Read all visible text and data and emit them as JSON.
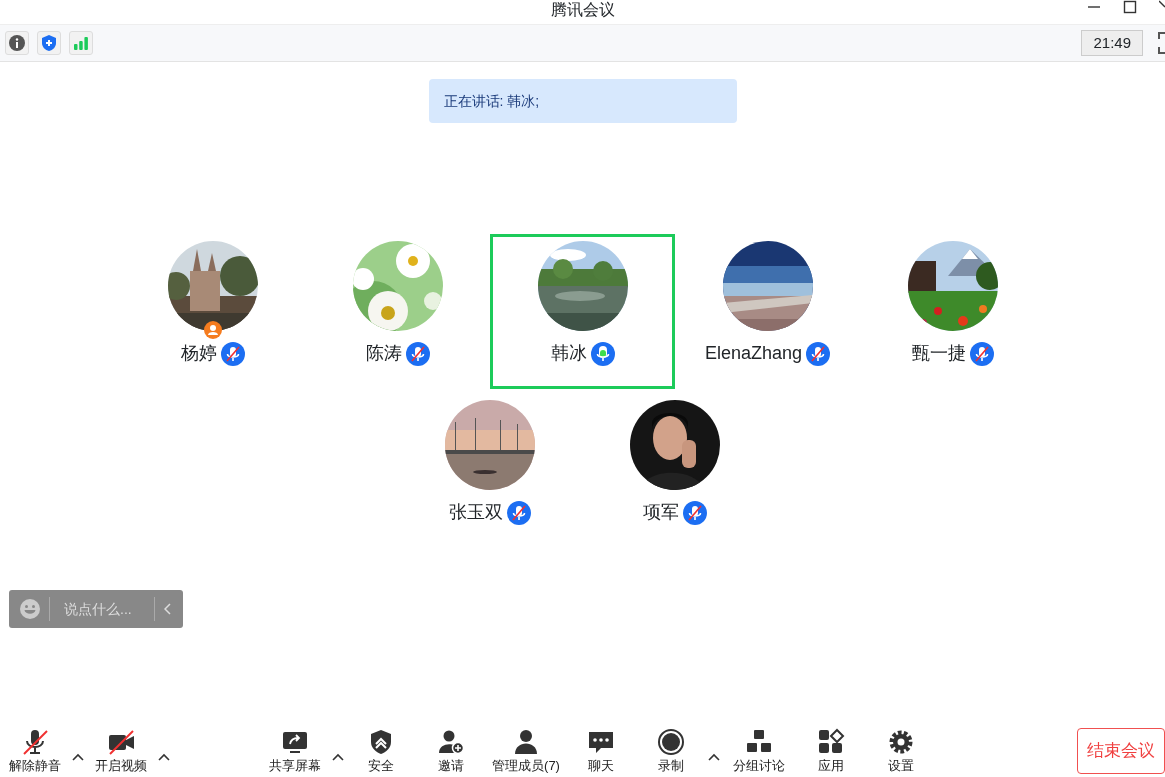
{
  "window": {
    "title": "腾讯会议"
  },
  "top_bar": {
    "icons": [
      {
        "kind": "info"
      },
      {
        "kind": "shield"
      },
      {
        "kind": "signal"
      }
    ],
    "time": "21:49"
  },
  "speaking_banner": "正在讲话: 韩冰;",
  "participants": [
    {
      "name": "杨婷",
      "mic_muted": true,
      "speaking": false,
      "host": true,
      "selected": false
    },
    {
      "name": "陈涛",
      "mic_muted": true,
      "speaking": false,
      "host": false,
      "selected": false
    },
    {
      "name": "韩冰",
      "mic_muted": false,
      "speaking": true,
      "host": false,
      "selected": true
    },
    {
      "name": "ElenaZhang",
      "mic_muted": true,
      "speaking": false,
      "host": false,
      "selected": false
    },
    {
      "name": "甄一捷",
      "mic_muted": true,
      "speaking": false,
      "host": false,
      "selected": false
    },
    {
      "name": "张玉双",
      "mic_muted": true,
      "speaking": false,
      "host": false,
      "selected": false
    },
    {
      "name": "项军",
      "mic_muted": true,
      "speaking": false,
      "host": false,
      "selected": false
    }
  ],
  "chat_input": {
    "placeholder": "说点什么..."
  },
  "toolbar": [
    {
      "kind": "mic",
      "label": "解除静音",
      "off": true,
      "has_menu": true
    },
    {
      "kind": "camera",
      "label": "开启视频",
      "off": true,
      "has_menu": true
    },
    {
      "kind": "share",
      "label": "共享屏幕",
      "off": false,
      "has_menu": true
    },
    {
      "kind": "security",
      "label": "安全",
      "off": false,
      "has_menu": false
    },
    {
      "kind": "invite",
      "label": "邀请",
      "off": false,
      "has_menu": false
    },
    {
      "kind": "members",
      "label": "管理成员(7)",
      "off": false,
      "has_menu": false
    },
    {
      "kind": "chat",
      "label": "聊天",
      "off": false,
      "has_menu": false
    },
    {
      "kind": "record",
      "label": "录制",
      "off": false,
      "has_menu": true
    },
    {
      "kind": "breakout",
      "label": "分组讨论",
      "off": false,
      "has_menu": false
    },
    {
      "kind": "apps",
      "label": "应用",
      "off": false,
      "has_menu": false
    },
    {
      "kind": "settings",
      "label": "设置",
      "off": false,
      "has_menu": false
    }
  ],
  "end_button": "结束会议"
}
